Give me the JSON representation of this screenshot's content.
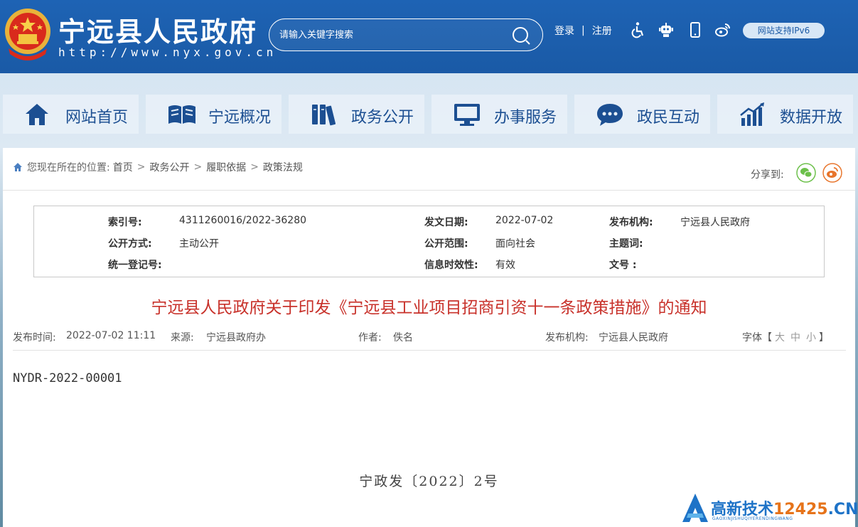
{
  "header": {
    "site_title": "宁远县人民政府",
    "site_url": "http://www.nyx.gov.cn",
    "search_placeholder": "请输入关键字搜索",
    "login": "登录",
    "separator": "|",
    "register": "注册",
    "ipv6_badge": "网站支持IPv6",
    "icons": [
      "accessibility-icon",
      "robot-icon",
      "mobile-icon",
      "weibo-icon"
    ]
  },
  "nav": {
    "items": [
      {
        "label": "网站首页",
        "icon": "home-icon"
      },
      {
        "label": "宁远概况",
        "icon": "book-icon"
      },
      {
        "label": "政务公开",
        "icon": "books-icon"
      },
      {
        "label": "办事服务",
        "icon": "monitor-icon"
      },
      {
        "label": "政民互动",
        "icon": "chat-icon"
      },
      {
        "label": "数据开放",
        "icon": "chart-icon"
      }
    ]
  },
  "breadcrumb": {
    "prefix": "您现在所在的位置:",
    "items": [
      "首页",
      "政务公开",
      "履职依据",
      "政策法规"
    ],
    "arrow": ">"
  },
  "share": {
    "label": "分享到:"
  },
  "meta": {
    "index_no_label": "索引号:",
    "index_no": "4311260016/2022-36280",
    "issue_date_label": "发文日期:",
    "issue_date": "2022-07-02",
    "publisher_label": "发布机构:",
    "publisher": "宁远县人民政府",
    "open_mode_label": "公开方式:",
    "open_mode": "主动公开",
    "open_scope_label": "公开范围:",
    "open_scope": "面向社会",
    "subject_label": "主题词:",
    "reg_no_label": "统一登记号:",
    "validity_label": "信息时效性:",
    "validity": "有效",
    "doc_no_label": "文号 :"
  },
  "document": {
    "title": "宁远县人民政府关于印发《宁远县工业项目招商引资十一条政策措施》的通知",
    "publish_time_label": "发布时间:",
    "publish_time": "2022-07-02 11:11",
    "source_label": "来源:",
    "source": "宁远县政府办",
    "author_label": "作者:",
    "author": "佚名",
    "publisher_label": "发布机构:",
    "publisher": "宁远县人民政府",
    "font_size_label": "字体【",
    "font_large": "大",
    "font_medium": "中",
    "font_small": "小",
    "font_close": "】",
    "doc_number": "NYDR-2022-00001",
    "wenhao": "宁政发〔2022〕2号"
  },
  "watermark": {
    "text_main": "高新技术",
    "text_num": "12425",
    "text_tld": ".CN",
    "subtitle": "GAOXINJISHUQIYERENDINGWANG"
  },
  "colors": {
    "header_blue": "#1e63b4",
    "nav_text": "#1c4f92",
    "title_red": "#c8312a"
  }
}
